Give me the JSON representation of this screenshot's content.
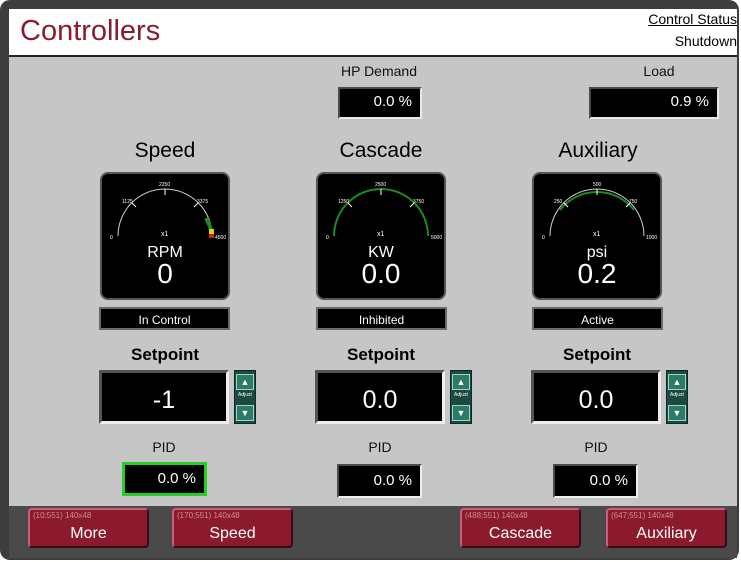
{
  "header": {
    "title": "Controllers",
    "status_label": "Control Status",
    "status_value": "Shutdown"
  },
  "hp_demand": {
    "label": "HP Demand",
    "value": "0.0 %"
  },
  "load": {
    "label": "Load",
    "value": "0.9 %"
  },
  "loops": [
    {
      "name": "Speed",
      "unit": "RPM",
      "value": "0",
      "multiplier": "x1",
      "ticks": [
        "0",
        "1125",
        "2250",
        "3375",
        "4500"
      ],
      "state": "In Control",
      "setpoint_label": "Setpoint",
      "setpoint": "-1",
      "adjust_label": "Adjust",
      "pid_label": "PID",
      "pid": "0.0 %"
    },
    {
      "name": "Cascade",
      "unit": "KW",
      "value": "0.0",
      "multiplier": "x1",
      "ticks": [
        "0",
        "1250",
        "2500",
        "3750",
        "5000"
      ],
      "state": "Inhibited",
      "setpoint_label": "Setpoint",
      "setpoint": "0.0",
      "adjust_label": "Adjust",
      "pid_label": "PID",
      "pid": "0.0 %"
    },
    {
      "name": "Auxiliary",
      "unit": "psi",
      "value": "0.2",
      "multiplier": "x1",
      "ticks": [
        "0",
        "250",
        "500",
        "750",
        "1000"
      ],
      "state": "Active",
      "setpoint_label": "Setpoint",
      "setpoint": "0.0",
      "adjust_label": "Adjust",
      "pid_label": "PID",
      "pid": "0.0 %"
    }
  ],
  "nav": [
    {
      "label": "More",
      "tag": "(10;551) 140x48"
    },
    {
      "label": "Speed",
      "tag": "(170;551) 140x48"
    },
    {
      "label": "Cascade",
      "tag": "(488;551) 140x48"
    },
    {
      "label": "Auxiliary",
      "tag": "(647;551) 140x48"
    }
  ],
  "colors": {
    "brand": "#8b1a33",
    "gauge_arc": "#1f8a1f",
    "focus": "#22d022",
    "nav_button": "#8a1a2c"
  }
}
